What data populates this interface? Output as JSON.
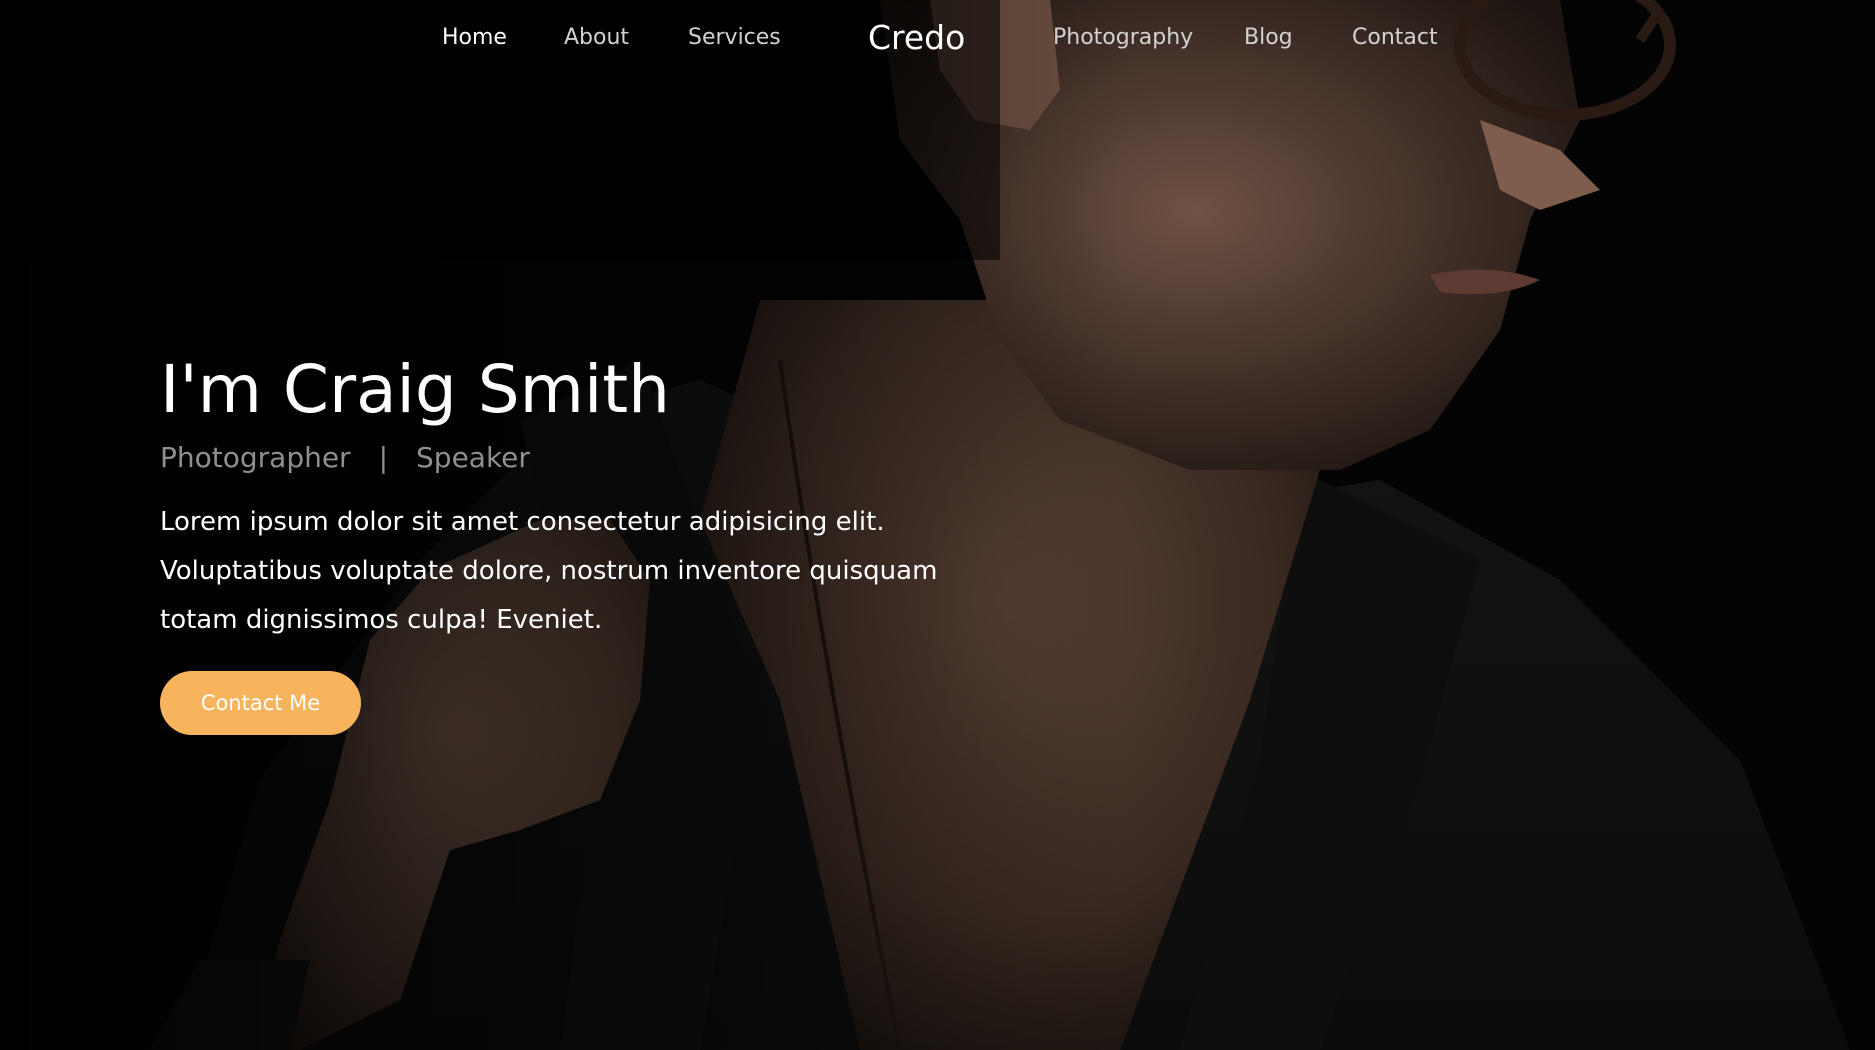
{
  "nav": {
    "left_links": [
      "Home",
      "About",
      "Services"
    ],
    "brand": "Credo",
    "right_links": [
      "Photography",
      "Blog",
      "Contact"
    ],
    "active": "Home"
  },
  "hero": {
    "title": "I'm Craig Smith",
    "roles": [
      "Photographer",
      "Speaker"
    ],
    "role_separator": "|",
    "description": "Lorem ipsum dolor sit amet consectetur adipisicing elit. Voluptatibus voluptate dolore, nostrum inventore quisquam totam dignissimos culpa! Eveniet.",
    "cta_label": "Contact Me"
  },
  "colors": {
    "accent": "#f8b45d",
    "background": "#050505",
    "text": "#ffffff",
    "muted": "#8f8f8f"
  }
}
